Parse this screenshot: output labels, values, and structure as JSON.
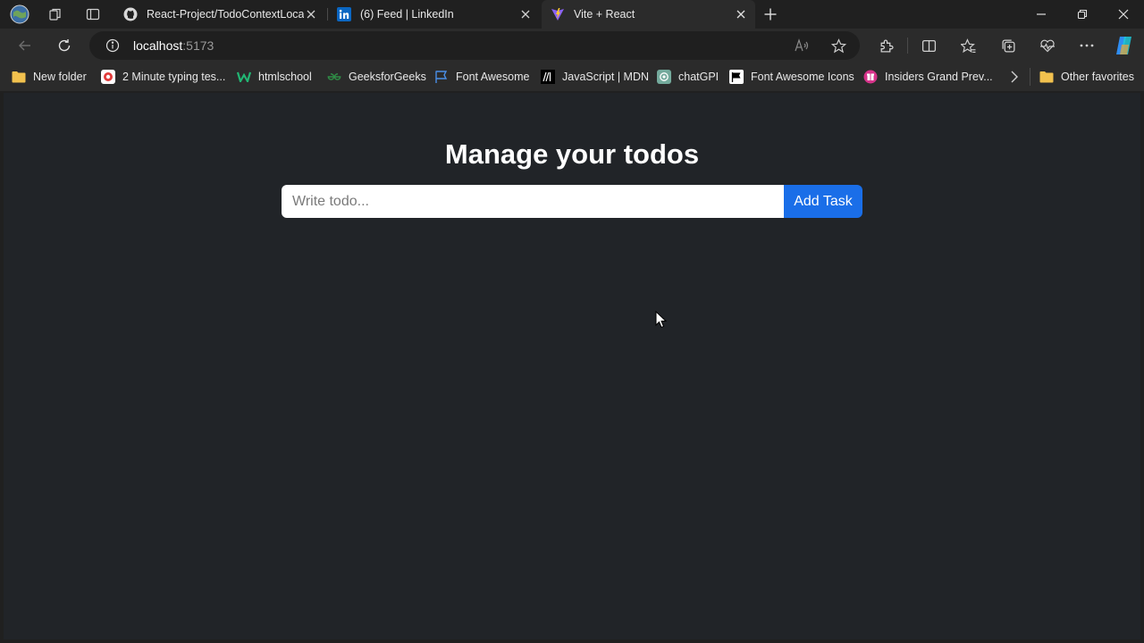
{
  "browser": {
    "tabs": [
      {
        "title": "React-Project/TodoContextLocal/",
        "icon": "github-icon",
        "active": false
      },
      {
        "title": "(6) Feed | LinkedIn",
        "icon": "linkedin-icon",
        "active": false
      },
      {
        "title": "Vite + React",
        "icon": "vite-icon",
        "active": true
      }
    ],
    "address": {
      "host": "localhost",
      "port": ":5173"
    },
    "favorites": [
      {
        "label": "New folder",
        "icon": "folder-icon"
      },
      {
        "label": "2 Minute typing tes...",
        "icon": "typing-test-icon"
      },
      {
        "label": "htmlschool",
        "icon": "htmlschool-icon"
      },
      {
        "label": "GeeksforGeeks",
        "icon": "geeksforgeeks-icon"
      },
      {
        "label": "Font Awesome",
        "icon": "flag-icon"
      },
      {
        "label": "JavaScript | MDN",
        "icon": "mdn-icon"
      },
      {
        "label": "chatGPI",
        "icon": "chatgpt-icon"
      },
      {
        "label": "Font Awesome Icons",
        "icon": "flag-icon"
      },
      {
        "label": "Insiders Grand Prev...",
        "icon": "insiders-icon"
      }
    ],
    "other_favorites": "Other favorites"
  },
  "page": {
    "heading": "Manage your todos",
    "input_placeholder": "Write todo...",
    "add_button": "Add Task"
  },
  "colors": {
    "page_background": "#212428",
    "button": "#1a6ee8",
    "chrome": "#2b2b2b"
  }
}
